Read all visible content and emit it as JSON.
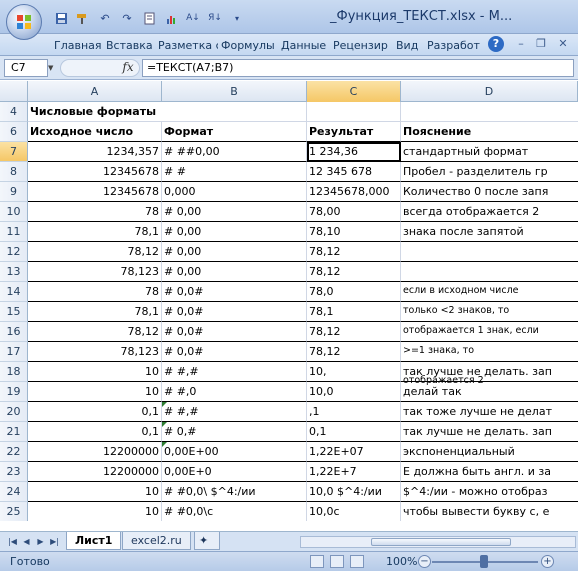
{
  "title": "_Функция_ТЕКСТ.xlsx - M...",
  "ribbon_tabs": [
    "Главная",
    "Вставка",
    "Разметка с",
    "Формулы",
    "Данные",
    "Рецензир",
    "Вид",
    "Разработ"
  ],
  "formula_bar": {
    "cell_ref": "C7",
    "fx": "fx",
    "formula": "=ТЕКСТ(A7;B7)"
  },
  "columns": [
    "A",
    "B",
    "C",
    "D"
  ],
  "selected_column": "C",
  "selected_row": "7",
  "rows": [
    {
      "n": "4",
      "a": "Числовые форматы",
      "b": "",
      "c": "",
      "d": ""
    },
    {
      "n": "6",
      "a": "Исходное число",
      "b": "Формат",
      "c": "Результат",
      "d": "Пояснение"
    },
    {
      "n": "7",
      "a": "1234,357",
      "b": "# ##0,00",
      "c": "1 234,36",
      "d": "стандартный формат"
    },
    {
      "n": "8",
      "a": "12345678",
      "b": "# #",
      "c": "12 345 678",
      "d": "Пробел - разделитель гр"
    },
    {
      "n": "9",
      "a": "12345678",
      "b": "0,000",
      "c": "12345678,000",
      "d": "Количество 0 после запя"
    },
    {
      "n": "10",
      "a": "78",
      "b": "# 0,00",
      "c": "78,00",
      "d": "всегда отображается 2"
    },
    {
      "n": "11",
      "a": "78,1",
      "b": "# 0,00",
      "c": "78,10",
      "d": "знака после запятой"
    },
    {
      "n": "12",
      "a": "78,12",
      "b": "# 0,00",
      "c": "78,12",
      "d": ""
    },
    {
      "n": "13",
      "a": "78,123",
      "b": "# 0,00",
      "c": "78,12",
      "d": ""
    },
    {
      "n": "14",
      "a": "78",
      "b": "# 0,0#",
      "c": "78,0",
      "d": "если в исходном числе"
    },
    {
      "n": "15",
      "a": "78,1",
      "b": "# 0,0#",
      "c": "78,1",
      "d": "только <2 знаков, то"
    },
    {
      "n": "16",
      "a": "78,12",
      "b": "# 0,0#",
      "c": "78,12",
      "d": "отображается 1 знак, если"
    },
    {
      "n": "17",
      "a": "78,123",
      "b": "# 0,0#",
      "c": "78,12",
      "d": ">=1 знака, то"
    },
    {
      "n": "18",
      "a": "10",
      "b": "# #,#",
      "c": "10,",
      "d": "так лучше не делать. зап"
    },
    {
      "n": "19",
      "a": "10",
      "b": "# #,0",
      "c": "10,0",
      "d": "делай так"
    },
    {
      "n": "20",
      "a": "0,1",
      "b": "# #,#",
      "c": ",1",
      "d": "так тоже лучше не делат"
    },
    {
      "n": "21",
      "a": "0,1",
      "b": "# 0,#",
      "c": "0,1",
      "d": "так лучше не делать. зап"
    },
    {
      "n": "22",
      "a": "12200000",
      "b": "0,00E+00",
      "c": "1,22E+07",
      "d": "экспоненциальный"
    },
    {
      "n": "23",
      "a": "12200000",
      "b": "0,00E+0",
      "c": "1,22E+7",
      "d": "Е должна быть англ. и за"
    },
    {
      "n": "24",
      "a": "10",
      "b": "# #0,0\\ $^4:/ии",
      "c": "10,0 $^4:/ии",
      "d": "$^4:/ии - можно отобраз"
    },
    {
      "n": "25",
      "a": "10",
      "b": "# #0,0\\c",
      "c": "10,0c",
      "d": "чтобы вывести букву с, е"
    }
  ],
  "extra_note": "отображается 2",
  "sheet_tabs": [
    "Лист1",
    "excel2.ru"
  ],
  "status": "Готово",
  "zoom": "100%"
}
